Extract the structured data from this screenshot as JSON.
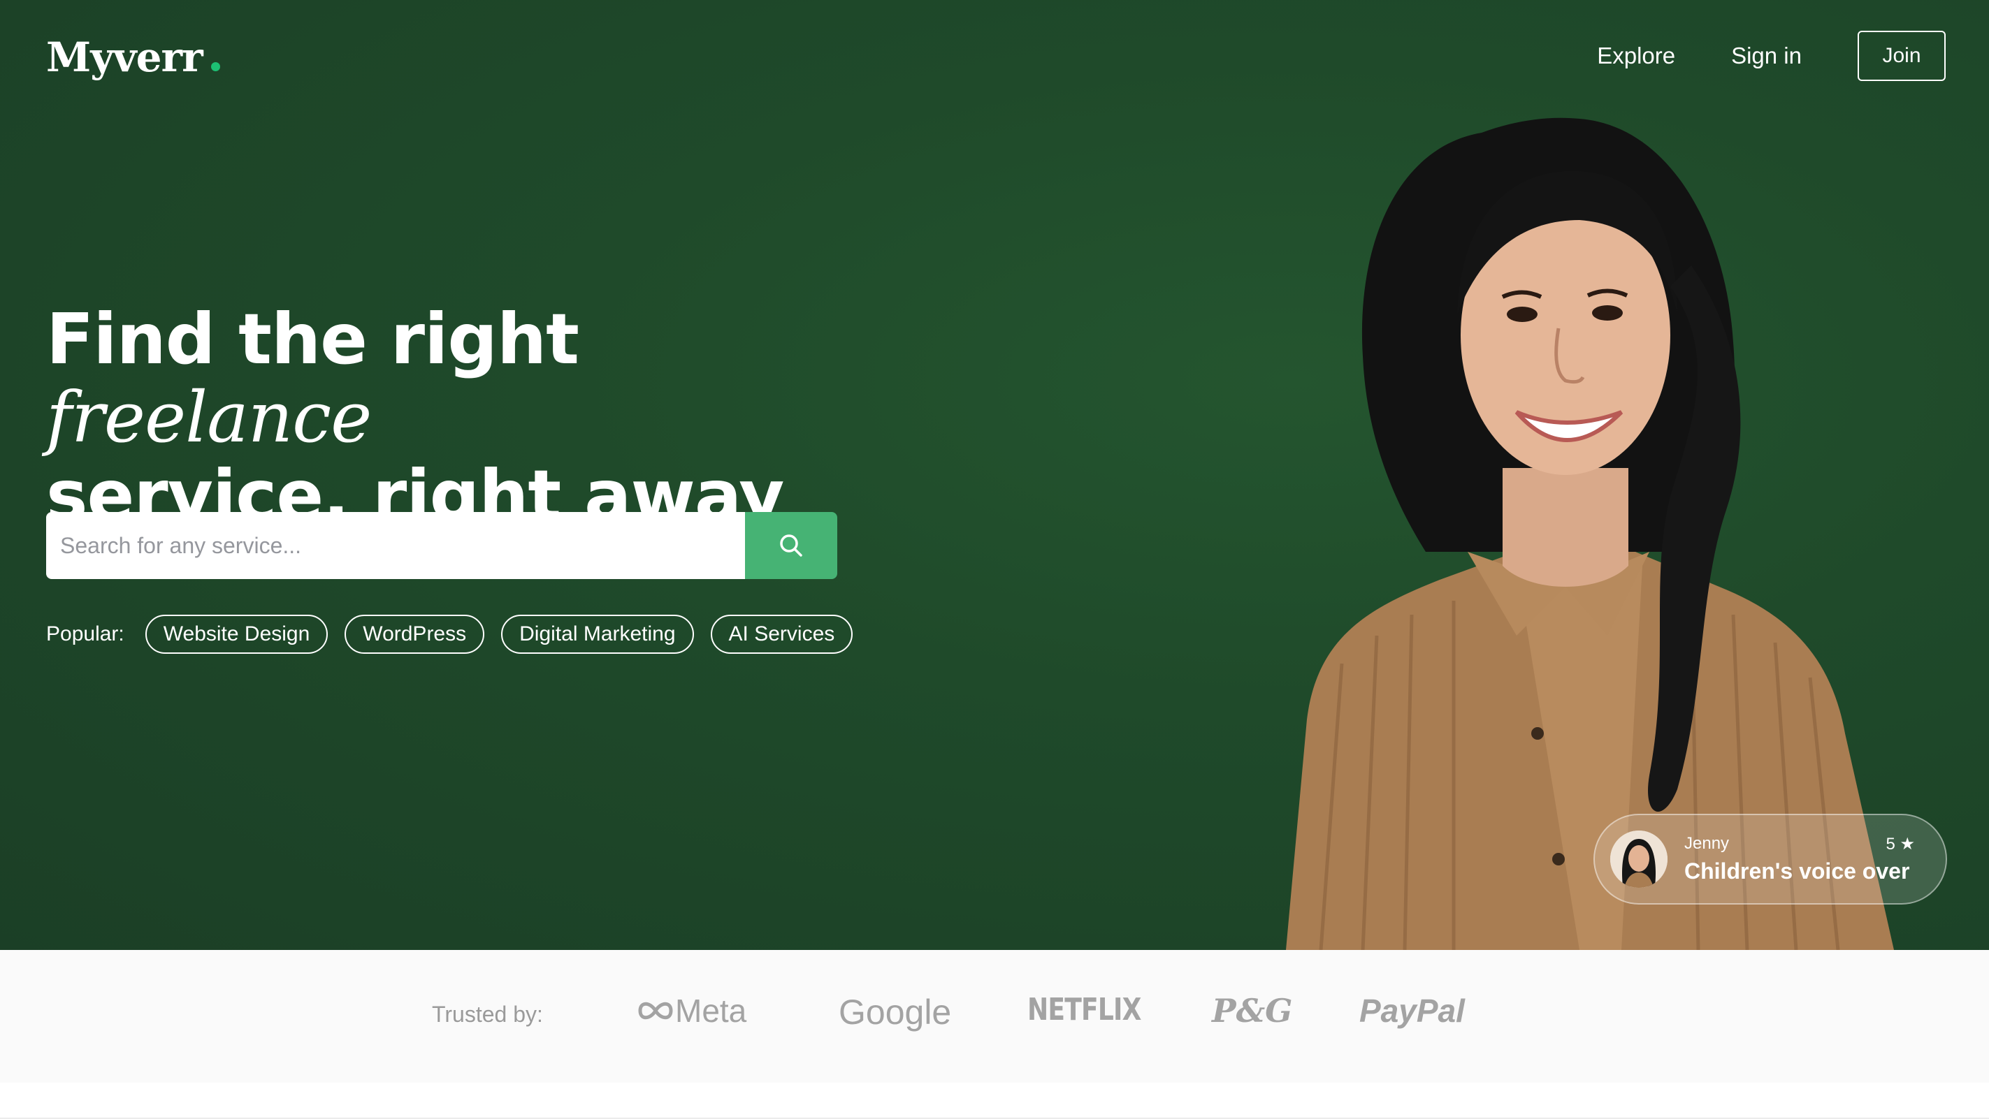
{
  "brand": {
    "logo_text": "Myverr",
    "accent_color": "#1dbf73"
  },
  "nav": {
    "explore": "Explore",
    "sign_in": "Sign in",
    "join": "Join"
  },
  "hero": {
    "headline_part1": "Find the right ",
    "headline_italic": "freelance",
    "headline_part2": "service, right away",
    "background_color": "#1f4a2a"
  },
  "search": {
    "placeholder": "Search for any service...",
    "button_icon": "search-icon",
    "button_color": "#46b374"
  },
  "popular": {
    "label": "Popular:",
    "chips": [
      "Website Design",
      "WordPress",
      "Digital Marketing",
      "AI Services"
    ]
  },
  "profile_card": {
    "name": "Jenny",
    "rating": "5 ★",
    "service": "Children's voice over"
  },
  "trusted": {
    "label": "Trusted by:",
    "brands": [
      "Meta",
      "Google",
      "NETFLIX",
      "P&G",
      "PayPal"
    ]
  }
}
